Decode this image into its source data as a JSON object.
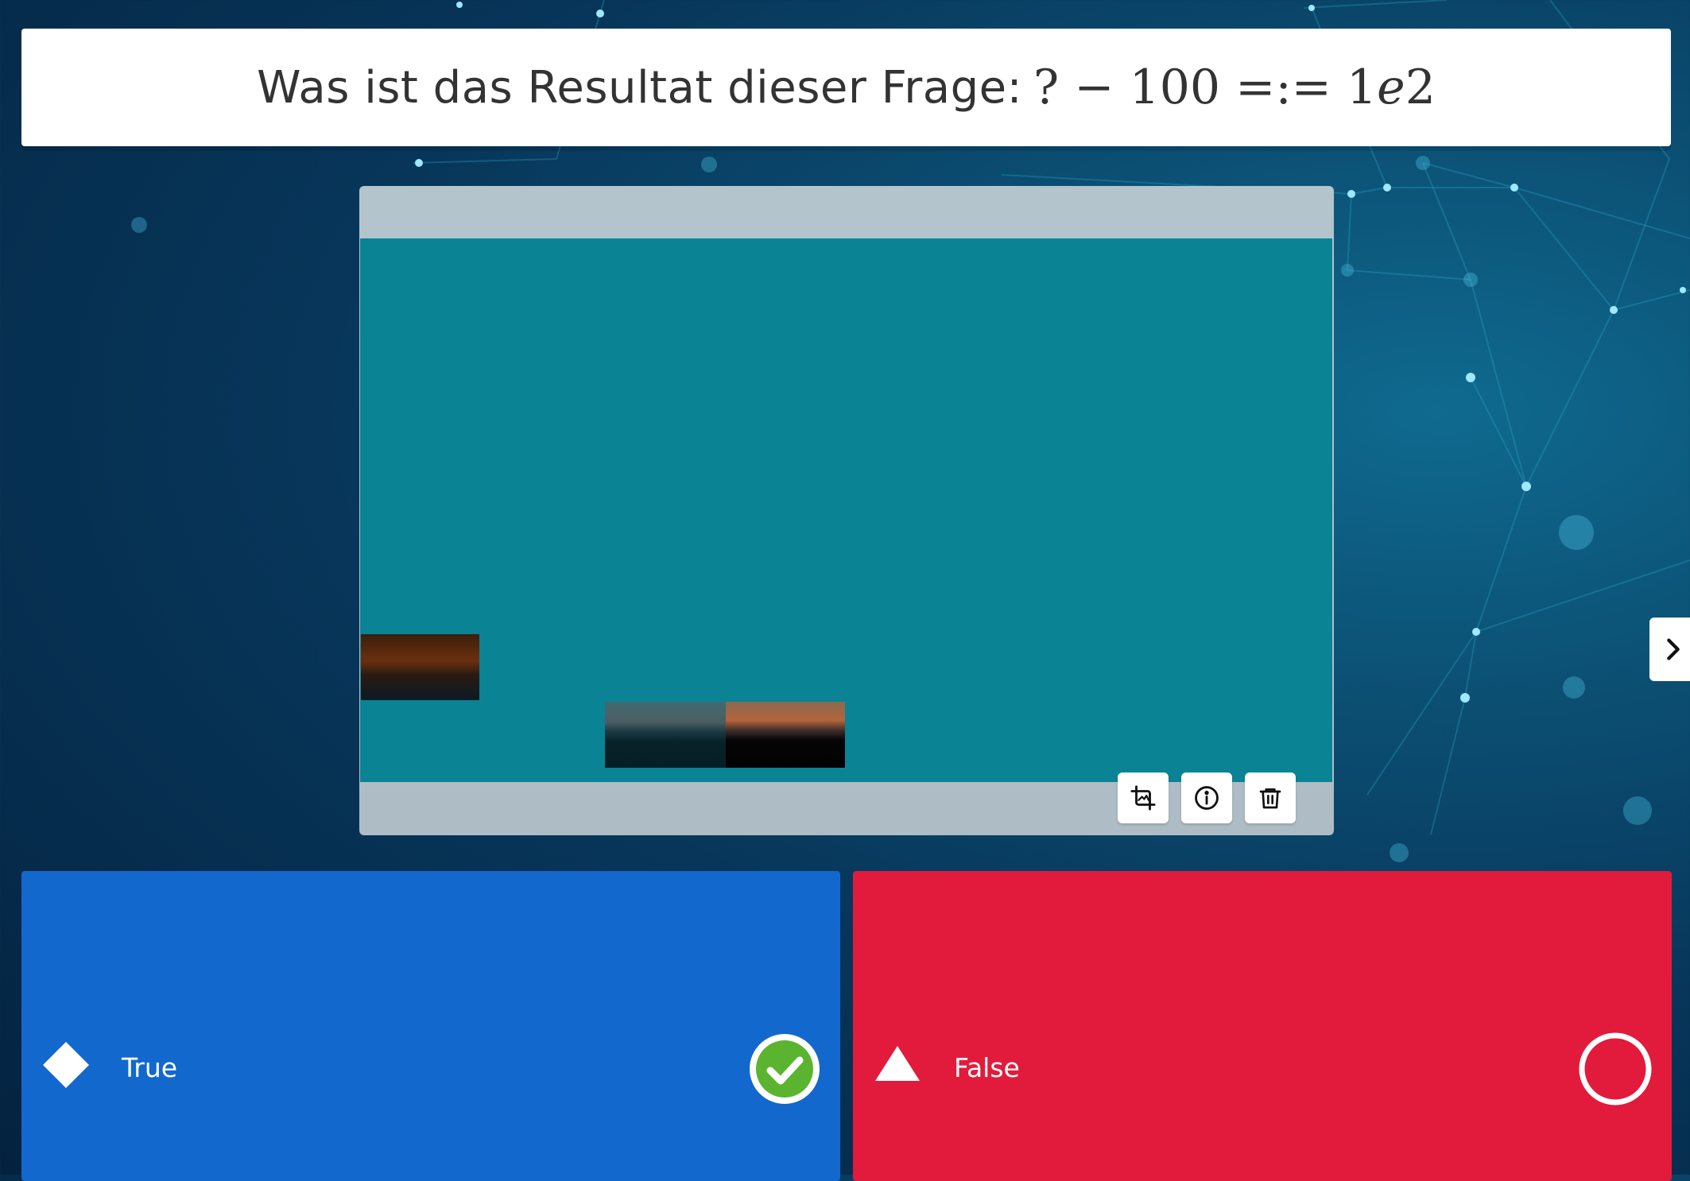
{
  "question": {
    "prefix": "Was ist das Resultat dieser Frage:",
    "formula": {
      "part1": "? − 100 =:= 1",
      "var": "e",
      "part2": "2"
    }
  },
  "media_tools": {
    "crop": "crop-image-icon",
    "info": "info-icon",
    "delete": "trash-icon"
  },
  "navigation": {
    "next": "chevron-right-icon"
  },
  "answers": [
    {
      "label": "True",
      "shape": "diamond",
      "color": "#1368ce",
      "state": "correct",
      "marker_icon": "check-circle-icon"
    },
    {
      "label": "False",
      "shape": "triangle",
      "color": "#e21b3c",
      "state": "not-selected",
      "marker_icon": "empty-circle-icon"
    }
  ],
  "colors": {
    "media_canvas": "#0a8395",
    "correct_badge": "#5ab430"
  }
}
